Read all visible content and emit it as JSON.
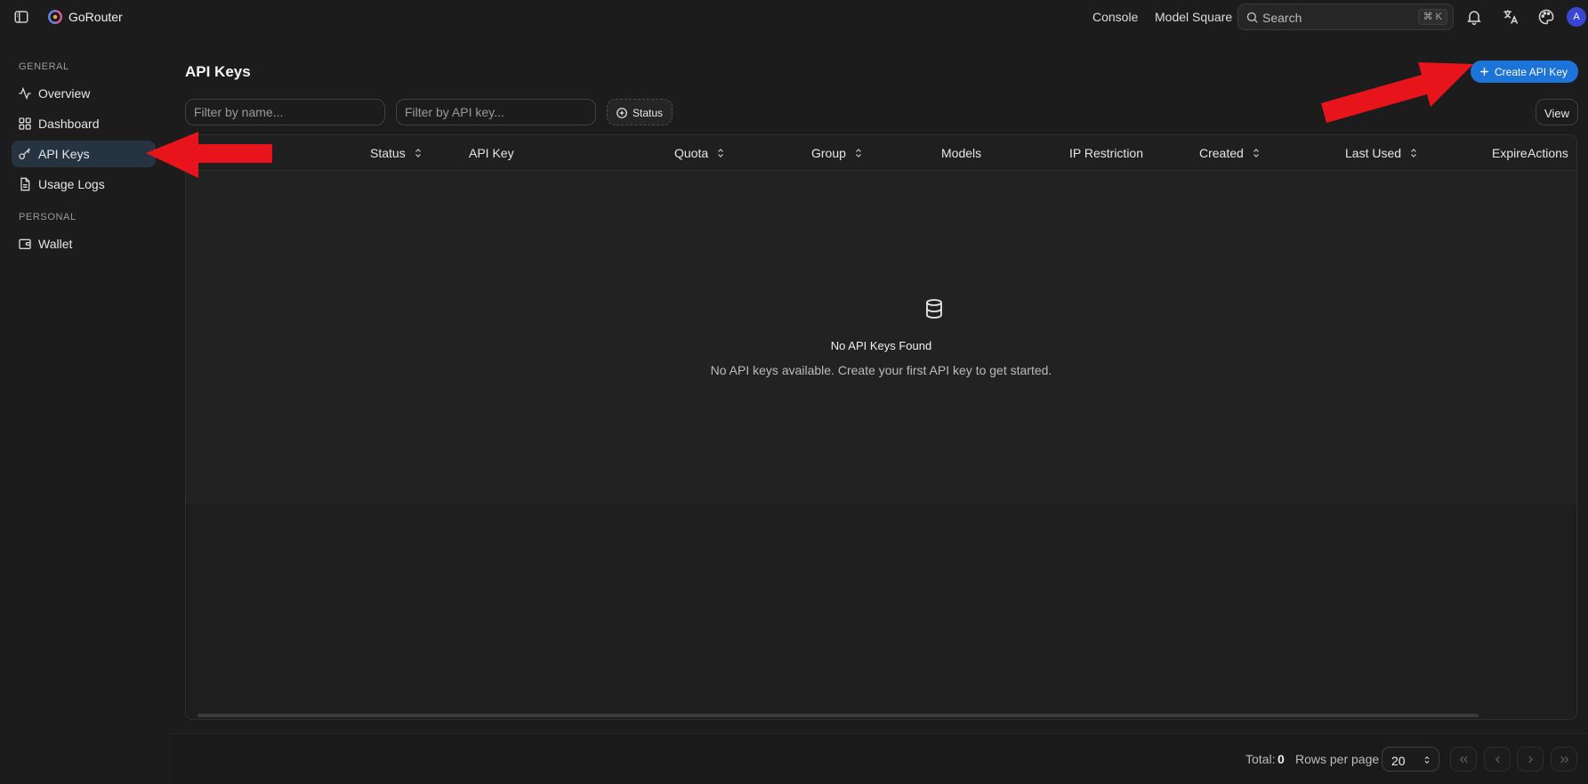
{
  "app": {
    "name": "GoRouter"
  },
  "topnav": {
    "links": [
      "Console",
      "Model Square"
    ],
    "search_placeholder": "Search",
    "shortcut": "⌘ K",
    "avatar_initial": "A"
  },
  "sidebar": {
    "sections": [
      {
        "label": "GENERAL",
        "items": [
          "Overview",
          "Dashboard",
          "API Keys",
          "Usage Logs"
        ]
      },
      {
        "label": "PERSONAL",
        "items": [
          "Wallet"
        ]
      }
    ],
    "active_item": "API Keys"
  },
  "page": {
    "title": "API Keys",
    "filter_name_placeholder": "Filter by name...",
    "filter_key_placeholder": "Filter by API key...",
    "status_button": "Status",
    "create_button": "Create API Key",
    "view_button": "View"
  },
  "table": {
    "columns": [
      "Status",
      "API Key",
      "Quota",
      "Group",
      "Models",
      "IP Restriction",
      "Created",
      "Last Used",
      "Expire",
      "Actions"
    ],
    "empty_title": "No API Keys Found",
    "empty_description": "No API keys available. Create your first API key to get started."
  },
  "pagination": {
    "total_label": "Total:",
    "total_value": "0",
    "rows_label": "Rows per page",
    "rows_value": "20"
  },
  "colors": {
    "background": "#1c1c1c",
    "accent": "#1d74d8",
    "active_nav": "#263441",
    "annotation_arrow": "#e8141b"
  }
}
